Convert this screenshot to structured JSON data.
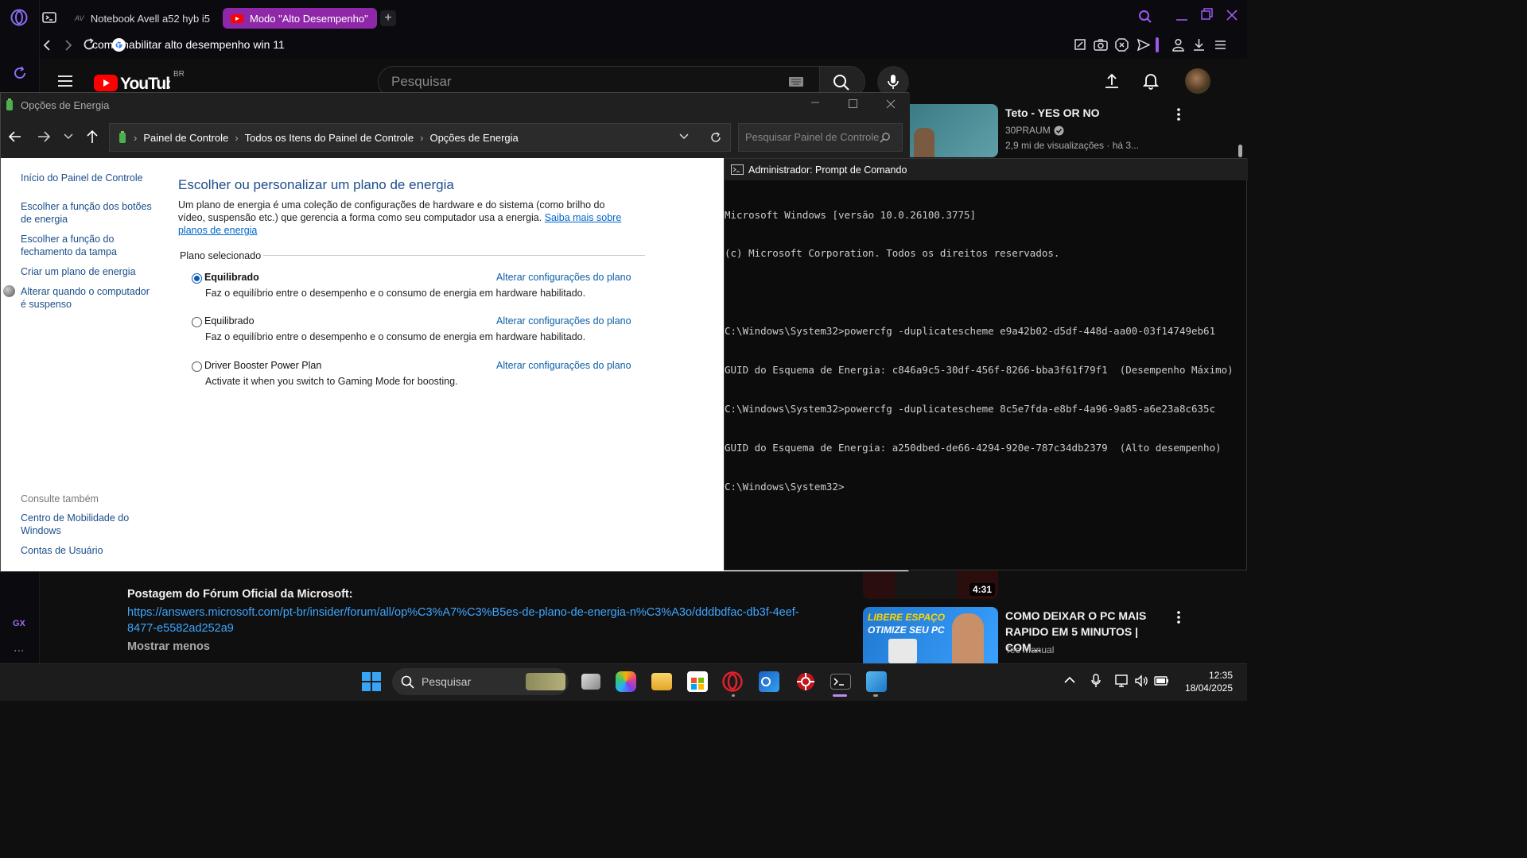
{
  "browser": {
    "tabs": [
      {
        "label": "Notebook Avell a52 hyb i5"
      },
      {
        "label": "Modo \"Alto Desempenho\""
      }
    ],
    "url": "como habilitar alto desempenho win 11",
    "sidebar_gx": "GX",
    "sidebar_more": "..."
  },
  "youtube": {
    "country": "BR",
    "search_placeholder": "Pesquisar",
    "rec1": {
      "title": "Teto - YES OR NO",
      "channel": "30PRAUM",
      "meta": "2,9 mi de visualizações · há 3..."
    },
    "rec2": {
      "duration": "4:31"
    },
    "rec3": {
      "title": "COMO DEIXAR O PC MAIS RAPIDO EM 5 MINUTOS | COM...",
      "channel": "Tec Manual",
      "thumb_line1": "LIBERE ESPAÇO",
      "thumb_line2": "OTIMIZE SEU PC"
    },
    "post_label": "Postagem do Fórum Oficial da Microsoft:",
    "post_link": "https://answers.microsoft.com/pt-br/insider/forum/all/op%C3%A7%C3%B5es-de-plano-de-energia-n%C3%A3o/dddbdfac-db3f-4eef-8477-e5582ad252a9",
    "show_less": "Mostrar menos"
  },
  "control_panel": {
    "title": "Opções de Energia",
    "breadcrumb": [
      "Painel de Controle",
      "Todos os Itens do Painel de Controle",
      "Opções de Energia"
    ],
    "search_placeholder": "Pesquisar Painel de Controle",
    "left_links": [
      "Início do Painel de Controle",
      "Escolher a função dos botões de energia",
      "Escolher a função do fechamento da tampa",
      "Criar um plano de energia",
      "Alterar quando o computador é suspenso"
    ],
    "see_also_label": "Consulte também",
    "see_also": [
      "Centro de Mobilidade do Windows",
      "Contas de Usuário"
    ],
    "heading": "Escolher ou personalizar um plano de energia",
    "description": "Um plano de energia é uma coleção de configurações de hardware e do sistema (como brilho do vídeo, suspensão etc.) que gerencia a forma como seu computador usa a energia.",
    "learn_more": "Saiba mais sobre planos de energia",
    "selected_plan_label": "Plano selecionado",
    "plans": [
      {
        "name": "Equilibrado",
        "desc": "Faz o equilíbrio entre o desempenho e o consumo de energia em hardware habilitado.",
        "link": "Alterar configurações do plano",
        "selected": true
      },
      {
        "name": "Equilibrado",
        "desc": "Faz o equilíbrio entre o desempenho e o consumo de energia em hardware habilitado.",
        "link": "Alterar configurações do plano",
        "selected": false
      },
      {
        "name": "Driver Booster Power Plan",
        "desc": "Activate it when you switch to Gaming Mode for boosting.",
        "link": "Alterar configurações do plano",
        "selected": false
      }
    ]
  },
  "cmd": {
    "title": "Administrador: Prompt de Comando",
    "lines": [
      "Microsoft Windows [versão 10.0.26100.3775]",
      "(c) Microsoft Corporation. Todos os direitos reservados.",
      "",
      "C:\\Windows\\System32>powercfg -duplicatescheme e9a42b02-d5df-448d-aa00-03f14749eb61",
      "GUID do Esquema de Energia: c846a9c5-30df-456f-8266-bba3f61f79f1  (Desempenho Máximo)",
      "C:\\Windows\\System32>powercfg -duplicatescheme 8c5e7fda-e8bf-4a96-9a85-a6e23a8c635c",
      "GUID do Esquema de Energia: a250dbed-de66-4294-920e-787c34db2379  (Alto desempenho)",
      "C:\\Windows\\System32>"
    ]
  },
  "taskbar": {
    "search_label": "Pesquisar",
    "time": "12:35",
    "date": "18/04/2025"
  }
}
